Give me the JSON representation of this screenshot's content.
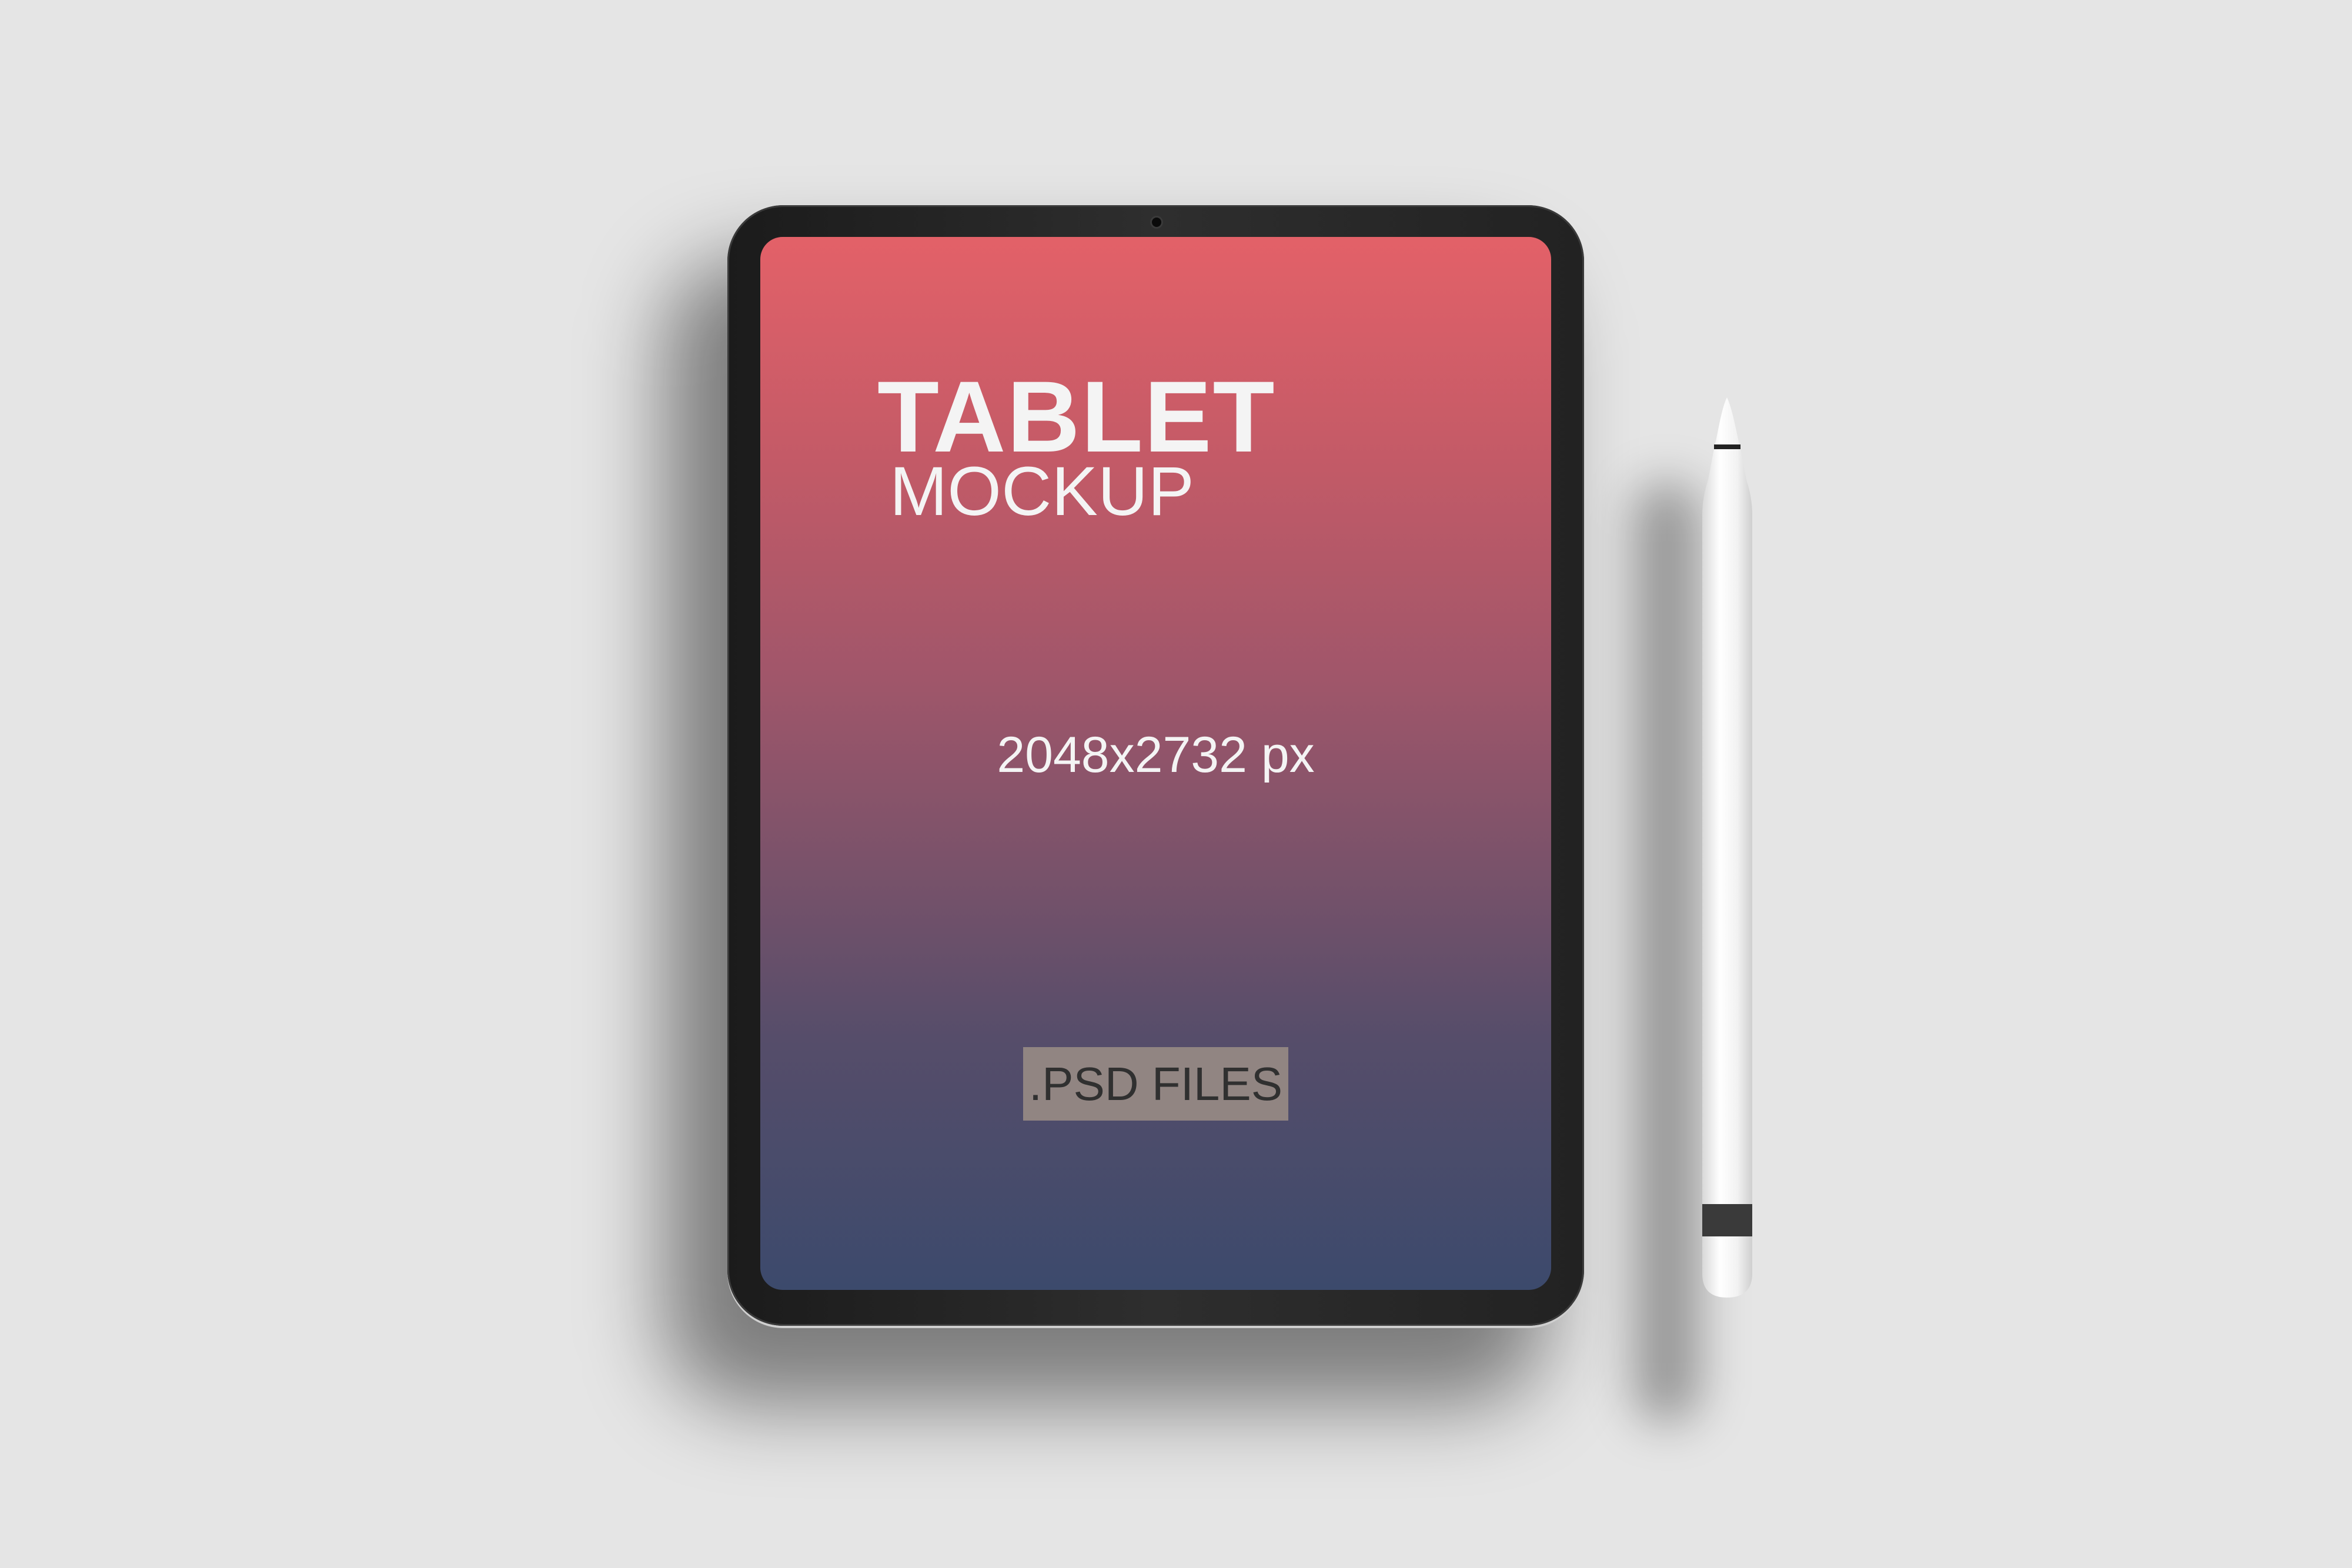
{
  "screen": {
    "title": "TABLET",
    "subtitle": "MOCKUP",
    "resolution": "2048x2732 px",
    "button_label": ".PSD FILES"
  },
  "colors": {
    "background": "#e5e5e5",
    "gradient_top": "#e36168",
    "gradient_bottom": "#3c4a6c",
    "button": "#918582"
  }
}
